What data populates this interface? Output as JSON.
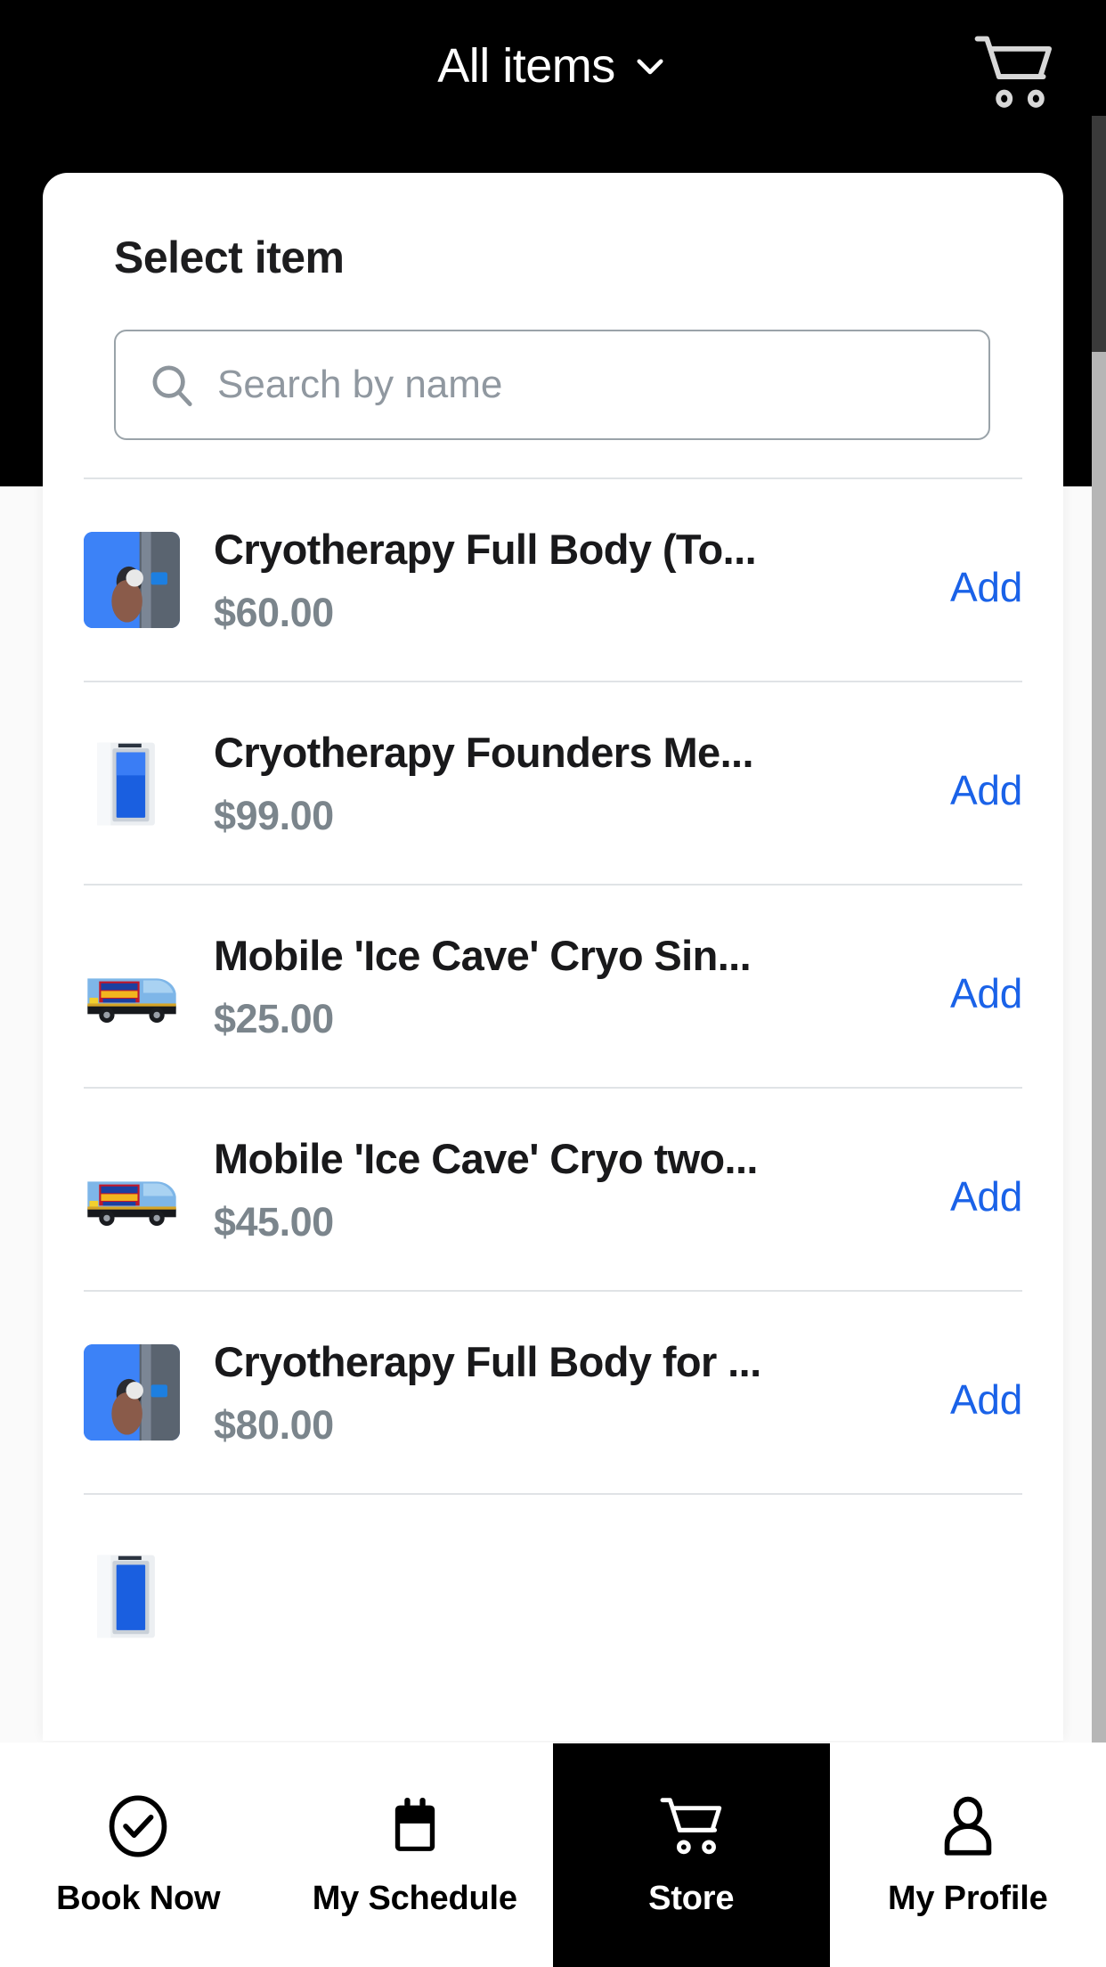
{
  "header": {
    "title": "All items",
    "chevron_icon": "chevron-down-icon",
    "cart_icon": "shopping-cart-icon"
  },
  "sheet": {
    "title": "Select item",
    "search": {
      "placeholder": "Search by name",
      "value": "",
      "icon": "search-icon"
    },
    "add_label": "Add",
    "items": [
      {
        "title": "Cryotherapy Full Body (To...",
        "price": "$60.00",
        "thumb": "cryo-chamber-blue-person",
        "add_label": "Add"
      },
      {
        "title": "Cryotherapy Founders Me...",
        "price": "$99.00",
        "thumb": "cryo-chamber-white",
        "add_label": "Add"
      },
      {
        "title": "Mobile 'Ice Cave' Cryo Sin...",
        "price": "$25.00",
        "thumb": "ice-cave-van",
        "add_label": "Add"
      },
      {
        "title": "Mobile 'Ice Cave' Cryo two...",
        "price": "$45.00",
        "thumb": "ice-cave-van",
        "add_label": "Add"
      },
      {
        "title": "Cryotherapy Full Body for ...",
        "price": "$80.00",
        "thumb": "cryo-chamber-blue-person",
        "add_label": "Add"
      }
    ]
  },
  "bottom_nav": {
    "items": [
      {
        "label": "Book Now",
        "icon": "check-circle-icon",
        "active": false
      },
      {
        "label": "My Schedule",
        "icon": "calendar-icon",
        "active": false
      },
      {
        "label": "Store",
        "icon": "shopping-cart-icon",
        "active": true
      },
      {
        "label": "My Profile",
        "icon": "person-icon",
        "active": false
      }
    ]
  },
  "colors": {
    "accent_link": "#1a62e8",
    "header_bg": "#000000",
    "price_text": "#7b858c",
    "active_tab_bg": "#000000"
  }
}
